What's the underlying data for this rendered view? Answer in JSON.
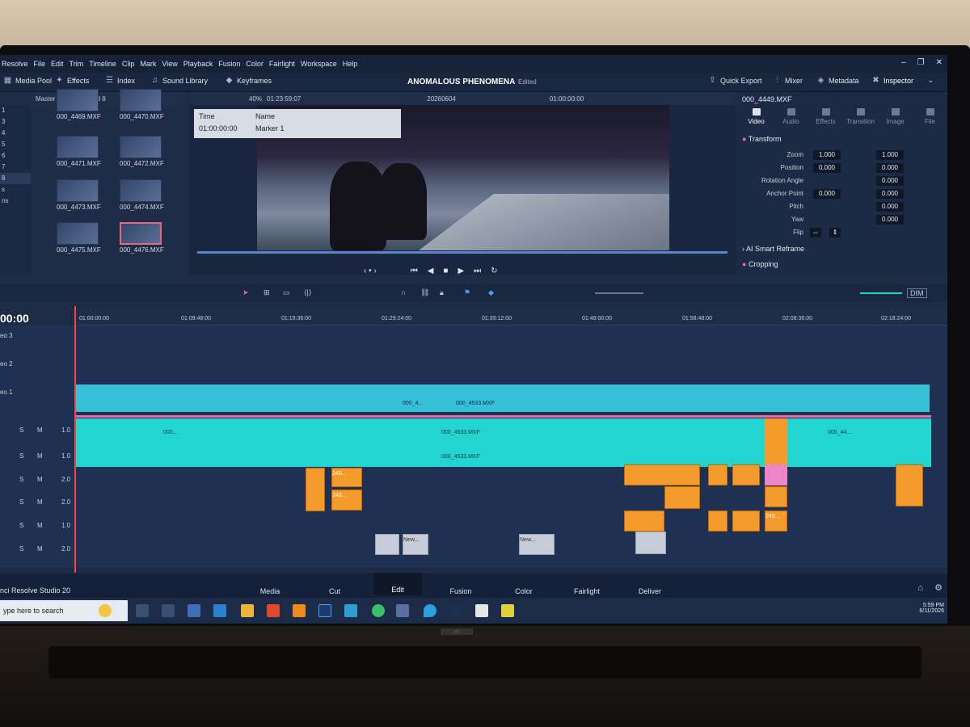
{
  "app": {
    "name": "Resolve",
    "footer_name": "nci Resolve Studio 20"
  },
  "menu": [
    "File",
    "Edit",
    "Trim",
    "Timeline",
    "Clip",
    "Mark",
    "View",
    "Playback",
    "Fusion",
    "Color",
    "Fairlight",
    "Workspace",
    "Help"
  ],
  "toolbar": {
    "media_pool": "Media Pool",
    "effects": "Effects",
    "index": "Index",
    "sound_library": "Sound Library",
    "keyframes": "Keyframes",
    "project_title": "ANOMALOUS PHENOMENA",
    "edited": "Edited",
    "quick_export": "Quick Export",
    "mixer": "Mixer",
    "metadata": "Metadata",
    "inspector": "Inspector"
  },
  "media_pool": {
    "path": "Master / VIDEO / Card 8",
    "zoom": "40%",
    "source_tc": "01:23:59:07",
    "clips": [
      "000_4469.MXF",
      "000_4470.MXF",
      "000_4471.MXF",
      "000_4472.MXF",
      "000_4473.MXF",
      "000_4474.MXF",
      "000_4475.MXF",
      "000_4476.MXF"
    ],
    "selected": "000_4476.MXF",
    "bin_items": [
      "1",
      "3",
      "4",
      "5",
      "6",
      "7",
      "8",
      "s",
      "ns"
    ]
  },
  "viewer": {
    "timeline_name": "20260604",
    "timecode": "01:00:00:00",
    "marker_headers": [
      "Time",
      "Name"
    ],
    "marker_time": "01:00:00:00",
    "marker_name": "Marker 1"
  },
  "inspector": {
    "clip": "000_4449.MXF",
    "tabs": [
      "Video",
      "Audio",
      "Effects",
      "Transition",
      "Image",
      "File"
    ],
    "transform": "Transform",
    "zoom": {
      "label": "Zoom",
      "x": "1.000",
      "y": "1.000"
    },
    "position": {
      "label": "Position",
      "x": "0.000",
      "y": "0.000"
    },
    "rotation": {
      "label": "Rotation Angle",
      "v": "0.000"
    },
    "anchor": {
      "label": "Anchor Point",
      "x": "0.000",
      "y": "0.000"
    },
    "pitch": {
      "label": "Pitch",
      "v": "0.000"
    },
    "yaw": {
      "label": "Yaw",
      "v": "0.000"
    },
    "flip": "Flip",
    "smart_reframe": "AI Smart Reframe",
    "cropping": "Cropping"
  },
  "timeline": {
    "timecode": "00:00",
    "dim": "DIM",
    "ruler": [
      "01:00:00:00",
      "01:09:48:00",
      "01:19:36:00",
      "01:29:24:00",
      "01:39:12:00",
      "01:49:00:00",
      "01:58:48:00",
      "02:08:36:00",
      "02:18:24:00"
    ],
    "tracks": {
      "v3": "eo 3",
      "v2": "eo 2",
      "v1": "eo 1"
    },
    "audio_levels": [
      "1.0",
      "1.0",
      "2.0",
      "2.0",
      "1.0",
      "2.0"
    ],
    "clip_label": "000_4533.MXF",
    "clip_short": "000_4...",
    "clip_000": "000...",
    "clip_000_44": "000_44...",
    "clip_240": "240...",
    "clip_new": "New...",
    "solo": "S",
    "mute": "M"
  },
  "pages": [
    "Media",
    "Cut",
    "Edit",
    "Fusion",
    "Color",
    "Fairlight",
    "Deliver"
  ],
  "active_page": "Edit",
  "taskbar": {
    "search": "ype here to search",
    "time": "5:59 PM",
    "date": "6/11/2026"
  },
  "colors": {
    "video_clip": "#36c1d8",
    "audio_clip": "#22d5d0",
    "orange_clip": "#f39b2c",
    "marker_line": "#e86aa8",
    "playhead": "#f04848"
  }
}
